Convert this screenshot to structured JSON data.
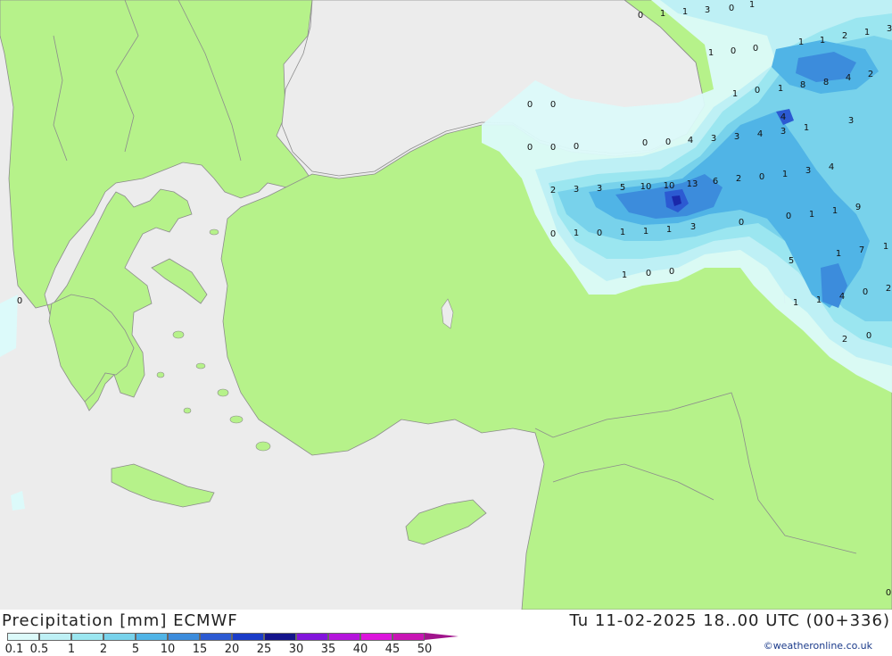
{
  "title": "Precipitation [mm] ECMWF",
  "datetime": "Tu 11-02-2025 18..00 UTC (00+336)",
  "credit": "©weatheronline.co.uk",
  "colors": {
    "land": "#b6f28a",
    "sea": "#ececec",
    "border": "#8c8c8c",
    "precip_0_1": "#dcfafa",
    "precip_0_5": "#bef0f5",
    "precip_1": "#9be6f0",
    "precip_2": "#78d2eb",
    "precip_5": "#50b4e6",
    "precip_10": "#3c8cdc",
    "precip_15": "#2c5ad2",
    "precip_25": "#1a28aa"
  },
  "legend": {
    "labels": [
      "0.1",
      "0.5",
      "1",
      "2",
      "5",
      "10",
      "15",
      "20",
      "25",
      "30",
      "35",
      "40",
      "45",
      "50"
    ],
    "colors": [
      "#dcfafa",
      "#bef0f5",
      "#9be6f0",
      "#78d2eb",
      "#50b4e6",
      "#3c8cdc",
      "#2c5ad2",
      "#1a3cc8",
      "#14148c",
      "#8214dc",
      "#b414dc",
      "#dc14dc",
      "#c814b4",
      "#a0148c"
    ]
  },
  "map_labels": [
    {
      "text": "0"
    },
    {
      "text": "1"
    },
    {
      "text": "1"
    },
    {
      "text": "3"
    },
    {
      "text": "0"
    },
    {
      "text": "1"
    },
    {
      "text": "1"
    },
    {
      "text": "0"
    },
    {
      "text": "0"
    },
    {
      "text": "1"
    },
    {
      "text": "1"
    },
    {
      "text": "2"
    },
    {
      "text": "1"
    },
    {
      "text": "3"
    },
    {
      "text": "8"
    },
    {
      "text": "8"
    },
    {
      "text": "4"
    },
    {
      "text": "2"
    },
    {
      "text": "1"
    },
    {
      "text": "0"
    },
    {
      "text": "1"
    },
    {
      "text": "0"
    },
    {
      "text": "0"
    },
    {
      "text": "4"
    },
    {
      "text": "3"
    },
    {
      "text": "0"
    },
    {
      "text": "0"
    },
    {
      "text": "0"
    },
    {
      "text": "0"
    },
    {
      "text": "0"
    },
    {
      "text": "4"
    },
    {
      "text": "3"
    },
    {
      "text": "3"
    },
    {
      "text": "4"
    },
    {
      "text": "3"
    },
    {
      "text": "1"
    },
    {
      "text": "2"
    },
    {
      "text": "3"
    },
    {
      "text": "3"
    },
    {
      "text": "5"
    },
    {
      "text": "10"
    },
    {
      "text": "10"
    },
    {
      "text": "13"
    },
    {
      "text": "6"
    },
    {
      "text": "2"
    },
    {
      "text": "0"
    },
    {
      "text": "1"
    },
    {
      "text": "3"
    },
    {
      "text": "4"
    },
    {
      "text": "0"
    },
    {
      "text": "1"
    },
    {
      "text": "1"
    },
    {
      "text": "9"
    },
    {
      "text": "0"
    },
    {
      "text": "1"
    },
    {
      "text": "0"
    },
    {
      "text": "1"
    },
    {
      "text": "1"
    },
    {
      "text": "1"
    },
    {
      "text": "3"
    },
    {
      "text": "0"
    },
    {
      "text": "1"
    },
    {
      "text": "7"
    },
    {
      "text": "1"
    },
    {
      "text": "5"
    },
    {
      "text": "1"
    },
    {
      "text": "0"
    },
    {
      "text": "0"
    },
    {
      "text": "1"
    },
    {
      "text": "1"
    },
    {
      "text": "4"
    },
    {
      "text": "0"
    },
    {
      "text": "2"
    },
    {
      "text": "2"
    },
    {
      "text": "0"
    },
    {
      "text": "0"
    },
    {
      "text": "0"
    }
  ]
}
